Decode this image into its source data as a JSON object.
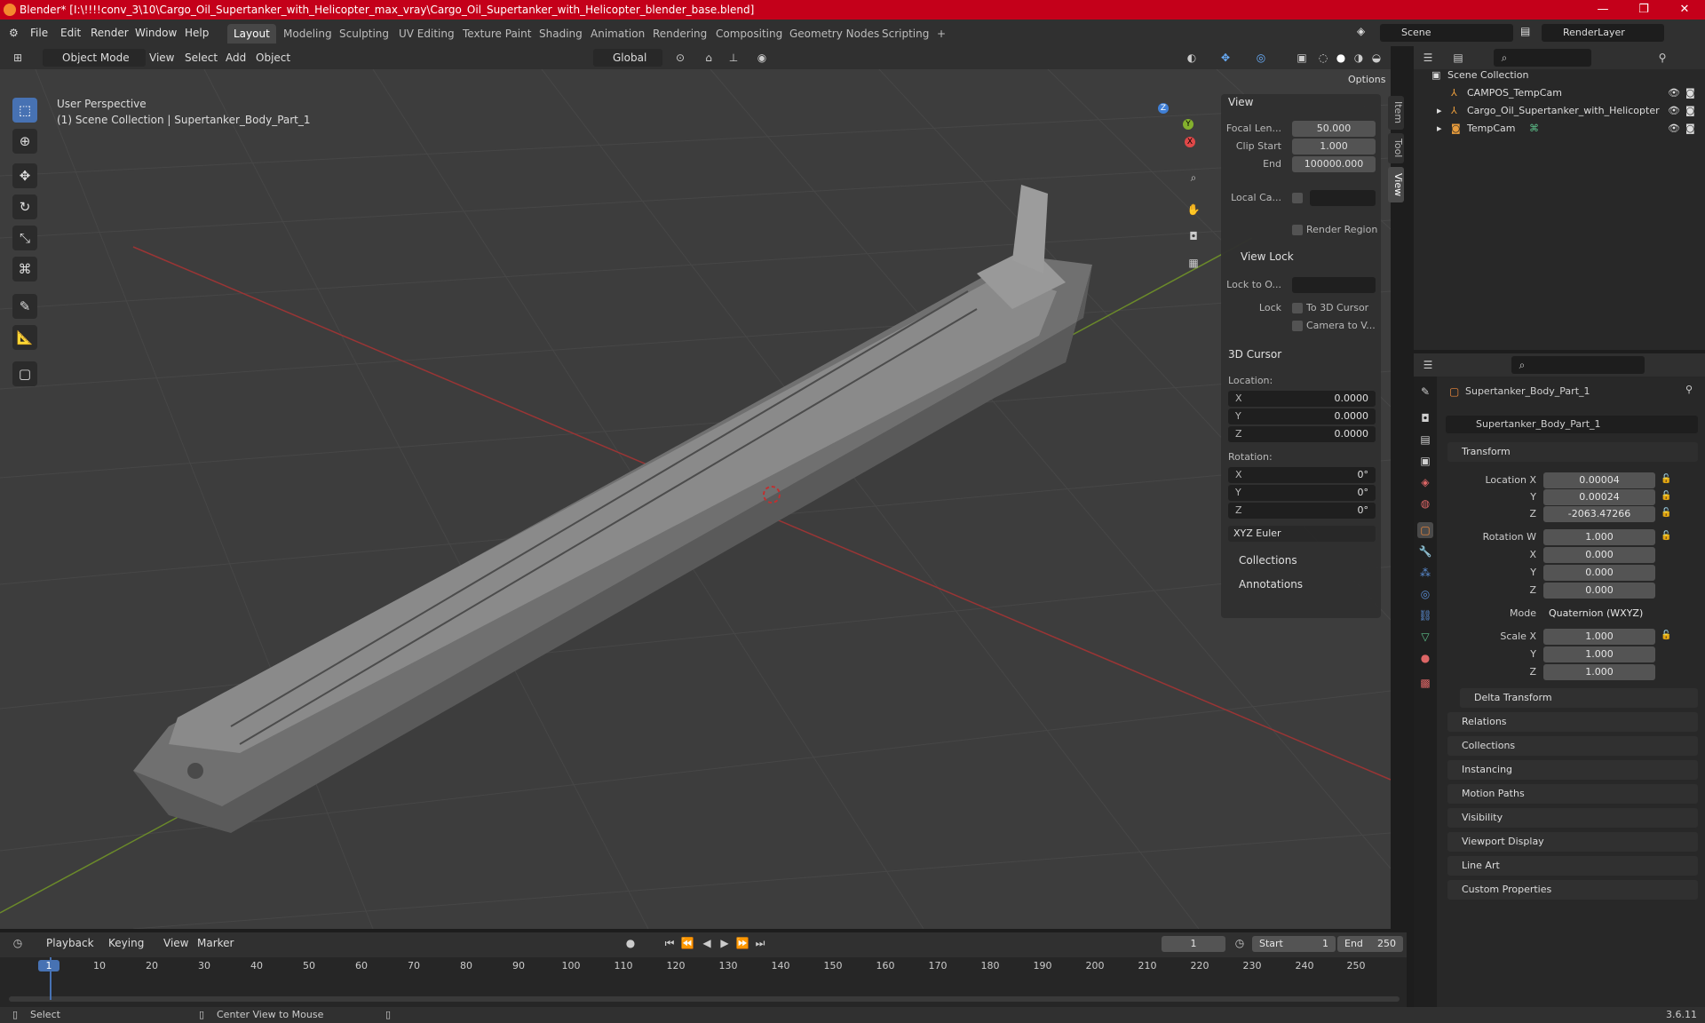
{
  "window": {
    "title": "Blender* [I:\\!!!!conv_3\\10\\Cargo_Oil_Supertanker_with_Helicopter_max_vray\\Cargo_Oil_Supertanker_with_Helicopter_blender_base.blend]",
    "minimize": "—",
    "maximize": "❐",
    "close": "✕"
  },
  "menu": [
    "File",
    "Edit",
    "Render",
    "Window",
    "Help"
  ],
  "workspaces": [
    "Layout",
    "Modeling",
    "Sculpting",
    "UV Editing",
    "Texture Paint",
    "Shading",
    "Animation",
    "Rendering",
    "Compositing",
    "Geometry Nodes",
    "Scripting",
    "+"
  ],
  "active_workspace": "Layout",
  "scene": "Scene",
  "render_layer": "RenderLayer",
  "viewport_header": {
    "mode": "Object Mode",
    "menus": [
      "View",
      "Select",
      "Add",
      "Object"
    ],
    "orientation": "Global",
    "options": "Options"
  },
  "viewport": {
    "perspective": "User Perspective",
    "collection_info": "(1) Scene Collection | Supertanker_Body_Part_1",
    "gizmo": {
      "z": "Z",
      "y": "Y",
      "x": "X"
    }
  },
  "npanel": {
    "tabs": [
      "Item",
      "Tool",
      "View"
    ],
    "view_header": "View",
    "focal_label": "Focal Len...",
    "focal": "50.000",
    "clip_start_label": "Clip Start",
    "clip_start": "1.000",
    "end_label": "End",
    "end": "100000.000",
    "local_camera_label": "Local Ca...",
    "render_region": "Render Region",
    "view_lock_header": "View Lock",
    "lock_to_label": "Lock to O...",
    "lock_label": "Lock",
    "to_3d_cursor": "To 3D Cursor",
    "camera_to_view": "Camera to V...",
    "cursor_header": "3D Cursor",
    "location_label": "Location:",
    "loc": [
      {
        "axis": "X",
        "value": "0.0000"
      },
      {
        "axis": "Y",
        "value": "0.0000"
      },
      {
        "axis": "Z",
        "value": "0.0000"
      }
    ],
    "rotation_label": "Rotation:",
    "rot": [
      {
        "axis": "X",
        "value": "0°"
      },
      {
        "axis": "Y",
        "value": "0°"
      },
      {
        "axis": "Z",
        "value": "0°"
      }
    ],
    "rotation_mode": "XYZ Euler",
    "collections": "Collections",
    "annotations": "Annotations"
  },
  "outliner": {
    "root": "Scene Collection",
    "items": [
      {
        "name": "CAMPOS_TempCam"
      },
      {
        "name": "Cargo_Oil_Supertanker_with_Helicopter"
      },
      {
        "name": "TempCam"
      }
    ]
  },
  "properties": {
    "object_name": "Supertanker_Body_Part_1",
    "data_name": "Supertanker_Body_Part_1",
    "transform_header": "Transform",
    "location_x_label": "Location X",
    "location": [
      "0.00004",
      "0.00024",
      "-2063.47266"
    ],
    "rotation_w_label": "Rotation W",
    "rotation": [
      "1.000",
      "0.000",
      "0.000",
      "0.000"
    ],
    "mode_label": "Mode",
    "mode": "Quaternion (WXYZ)",
    "scale_x_label": "Scale X",
    "scale": [
      "1.000",
      "1.000",
      "1.000"
    ],
    "axis_y": "Y",
    "axis_z": "Z",
    "axis_x": "X",
    "delta_transform": "Delta Transform",
    "sections": [
      "Relations",
      "Collections",
      "Instancing",
      "Motion Paths",
      "Visibility",
      "Viewport Display",
      "Line Art",
      "Custom Properties"
    ]
  },
  "timeline": {
    "menus": [
      "Playback",
      "Keying",
      "View",
      "Marker"
    ],
    "current_frame": "1",
    "start_label": "Start",
    "start": "1",
    "end_label": "End",
    "end": "250",
    "ticks": [
      "1",
      "10",
      "20",
      "30",
      "40",
      "50",
      "60",
      "70",
      "80",
      "90",
      "100",
      "110",
      "120",
      "130",
      "140",
      "150",
      "160",
      "170",
      "180",
      "190",
      "200",
      "210",
      "220",
      "230",
      "240",
      "250"
    ]
  },
  "statusbar": {
    "select": "Select",
    "center_view": "Center View to Mouse",
    "version": "3.6.11"
  }
}
